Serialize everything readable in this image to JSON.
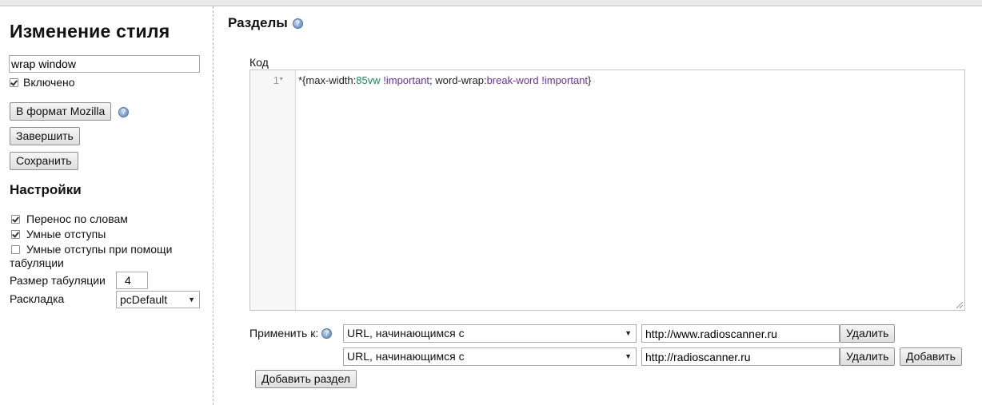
{
  "sidebar": {
    "title": "Изменение стиля",
    "style_name": "wrap window",
    "enabled_label": "Включено",
    "enabled": true,
    "mozilla_button": "В формат Mozilla",
    "finish_button": "Завершить",
    "save_button": "Сохранить",
    "settings_title": "Настройки",
    "options": {
      "word_wrap": {
        "label": "Перенос по словам",
        "checked": true
      },
      "smart_indent": {
        "label": "Умные отступы",
        "checked": true
      },
      "smart_tab_indent_line1": "Умные отступы при помощи",
      "smart_tab_indent_line2": "табуляции",
      "smart_tab_indent_checked": false
    },
    "tab_size_label": "Размер табуляции",
    "tab_size_value": "4",
    "keymap_label": "Раскладка",
    "keymap_value": "pcDefault"
  },
  "main": {
    "sections_title": "Разделы",
    "code_label": "Код",
    "line_number": "1",
    "code": {
      "t1": "*{max-width:",
      "n1": "85vw",
      "k1": "!important",
      "t2": "; word-wrap:",
      "k2": "break-word",
      "k3": "!important",
      "t3": "}"
    },
    "apply_label": "Применить к:",
    "rules": [
      {
        "type": "URL, начинающимся с",
        "value": "http://www.radioscanner.ru",
        "delete": "Удалить"
      },
      {
        "type": "URL, начинающимся с",
        "value": "http://radioscanner.ru",
        "delete": "Удалить",
        "add": "Добавить"
      }
    ],
    "add_section_button": "Добавить раздел"
  },
  "icons": {
    "help": "help-icon",
    "dropdown": "chevron-down-icon",
    "checkbox": "checkbox-icon"
  }
}
